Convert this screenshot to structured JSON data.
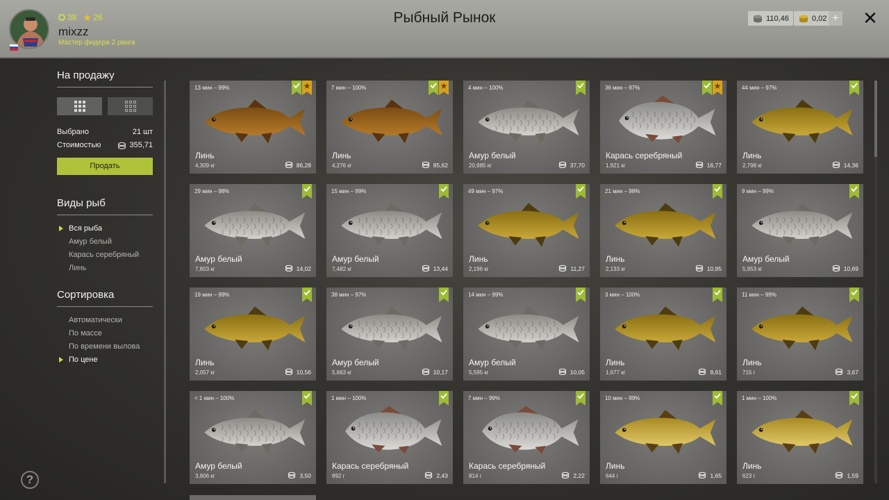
{
  "header": {
    "title": "Рыбный Рынок",
    "username": "mixzz",
    "rank_text": "Мастер фидера 2 ранга",
    "level": "38",
    "stars": "26",
    "silver": "110,46",
    "gold": "0,02",
    "plus_label": "+",
    "close_label": "✕"
  },
  "sidebar": {
    "sale_title": "На продажу",
    "selected_label": "Выбрано",
    "selected_value": "21 шт",
    "cost_label": "Стоимостью",
    "cost_value": "355,71",
    "sell_label": "Продать",
    "species_title": "Виды рыб",
    "species": [
      {
        "label": "Вся рыба",
        "active": true
      },
      {
        "label": "Амур белый",
        "active": false
      },
      {
        "label": "Карась серебряный",
        "active": false
      },
      {
        "label": "Линь",
        "active": false
      }
    ],
    "sort_title": "Сортировка",
    "sort": [
      {
        "label": "Автоматически",
        "active": false
      },
      {
        "label": "По массе",
        "active": false
      },
      {
        "label": "По времени вылова",
        "active": false
      },
      {
        "label": "По цене",
        "active": true
      }
    ],
    "help_label": "?"
  },
  "colors": {
    "accent": "#aec33a",
    "badge_green": "#9dbb35",
    "badge_gold": "#d9a21e",
    "header_bg": "#a0a09b"
  },
  "cards": [
    {
      "meta": "13 мин – 99%",
      "name": "Линь",
      "weight": "4,309 кг",
      "price": "86,28",
      "star": true,
      "fish": "tench-dark"
    },
    {
      "meta": "7 мин – 100%",
      "name": "Линь",
      "weight": "4,276 кг",
      "price": "85,62",
      "star": true,
      "fish": "tench-dark"
    },
    {
      "meta": "4 мин – 100%",
      "name": "Амур белый",
      "weight": "20,985 кг",
      "price": "37,70",
      "star": false,
      "fish": "amur"
    },
    {
      "meta": "36 мин – 97%",
      "name": "Карась серебряный",
      "weight": "1,921 кг",
      "price": "16,77",
      "star": true,
      "fish": "carp"
    },
    {
      "meta": "44 мин – 97%",
      "name": "Линь",
      "weight": "2,798 кг",
      "price": "14,36",
      "star": false,
      "fish": "tench"
    },
    {
      "meta": "29 мин – 98%",
      "name": "Амур белый",
      "weight": "7,803 кг",
      "price": "14,02",
      "star": false,
      "fish": "amur"
    },
    {
      "meta": "15 мин – 99%",
      "name": "Амур белый",
      "weight": "7,482 кг",
      "price": "13,44",
      "star": false,
      "fish": "amur"
    },
    {
      "meta": "49 мин – 97%",
      "name": "Линь",
      "weight": "2,196 кг",
      "price": "11,27",
      "star": false,
      "fish": "tench"
    },
    {
      "meta": "21 мин – 98%",
      "name": "Линь",
      "weight": "2,133 кг",
      "price": "10,95",
      "star": false,
      "fish": "tench"
    },
    {
      "meta": "9 мин – 99%",
      "name": "Амур белый",
      "weight": "5,953 кг",
      "price": "10,69",
      "star": false,
      "fish": "amur"
    },
    {
      "meta": "19 мин – 99%",
      "name": "Линь",
      "weight": "2,057 кг",
      "price": "10,56",
      "star": false,
      "fish": "tench"
    },
    {
      "meta": "38 мин – 97%",
      "name": "Амур белый",
      "weight": "5,663 кг",
      "price": "10,17",
      "star": false,
      "fish": "amur"
    },
    {
      "meta": "14 мин – 99%",
      "name": "Амур белый",
      "weight": "5,595 кг",
      "price": "10,05",
      "star": false,
      "fish": "amur"
    },
    {
      "meta": "3 мин – 100%",
      "name": "Линь",
      "weight": "1,677 кг",
      "price": "8,61",
      "star": false,
      "fish": "tench"
    },
    {
      "meta": "11 мин – 99%",
      "name": "Линь",
      "weight": "715 г",
      "price": "3,67",
      "star": false,
      "fish": "tench"
    },
    {
      "meta": "< 1 мин – 100%",
      "name": "Амур белый",
      "weight": "3,906 кг",
      "price": "3,50",
      "star": false,
      "fish": "amur"
    },
    {
      "meta": "1 мин – 100%",
      "name": "Карась серебряный",
      "weight": "892 г",
      "price": "2,43",
      "star": false,
      "fish": "carp"
    },
    {
      "meta": "7 мин – 99%",
      "name": "Карась серебряный",
      "weight": "814 г",
      "price": "2,22",
      "star": false,
      "fish": "carp"
    },
    {
      "meta": "10 мин – 99%",
      "name": "Линь",
      "weight": "644 г",
      "price": "1,65",
      "star": false,
      "fish": "tench-light"
    },
    {
      "meta": "1 мин – 100%",
      "name": "Линь",
      "weight": "623 г",
      "price": "1,59",
      "star": false,
      "fish": "tench-light"
    }
  ]
}
